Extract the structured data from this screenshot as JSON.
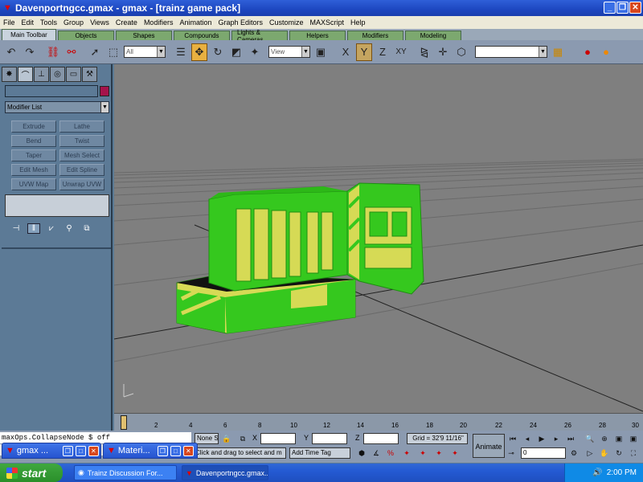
{
  "window": {
    "title": "Davenportngcc.gmax - gmax - [trainz game pack]"
  },
  "menu": [
    "File",
    "Edit",
    "Tools",
    "Group",
    "Views",
    "Create",
    "Modifiers",
    "Animation",
    "Graph Editors",
    "Customize",
    "MAXScript",
    "Help"
  ],
  "tabs": [
    "Main Toolbar",
    "Objects",
    "Shapes",
    "Compounds",
    "Lights & Cameras",
    "Helpers",
    "Modifiers",
    "Modeling"
  ],
  "toolbar": {
    "filter_select": "All",
    "refcoord_select": "View",
    "axis_x": "X",
    "axis_y": "Y",
    "axis_z": "Z",
    "axis_xy": "XY"
  },
  "command_panel": {
    "modifier_list": "Modifier List",
    "modifier_buttons": [
      "Extrude",
      "Lathe",
      "Bend",
      "Twist",
      "Taper",
      "Mesh Select",
      "Edit Mesh",
      "Edit Spline",
      "UVW Map",
      "Unwrap UVW"
    ],
    "color_swatch": "#a5134b"
  },
  "timeline": {
    "ticks": [
      "2",
      "4",
      "6",
      "8",
      "10",
      "12",
      "14",
      "16",
      "18",
      "20",
      "22",
      "24",
      "26",
      "28",
      "30"
    ]
  },
  "status": {
    "maxscript_line": "maxOps.CollapseNode $ off",
    "selection": "None S",
    "x_label": "X",
    "y_label": "Y",
    "z_label": "Z",
    "grid": "Grid = 32'9 11/16\"",
    "prompt": "Click and drag to select and m",
    "add_time_tag": "Add Time Tag",
    "animate": "Animate",
    "frame": "0"
  },
  "minimized_windows": [
    {
      "title": "gmax ..."
    },
    {
      "title": "Materi..."
    }
  ],
  "taskbar": {
    "start": "start",
    "buttons": [
      "Trainz Discussion For...",
      "Davenportngcc.gmax..."
    ],
    "clock": "2:00 PM"
  },
  "scene_colors": {
    "loco_green": "#35c81e",
    "loco_yellow": "#d6da55",
    "viewport_bg": "#7f7f7f"
  }
}
